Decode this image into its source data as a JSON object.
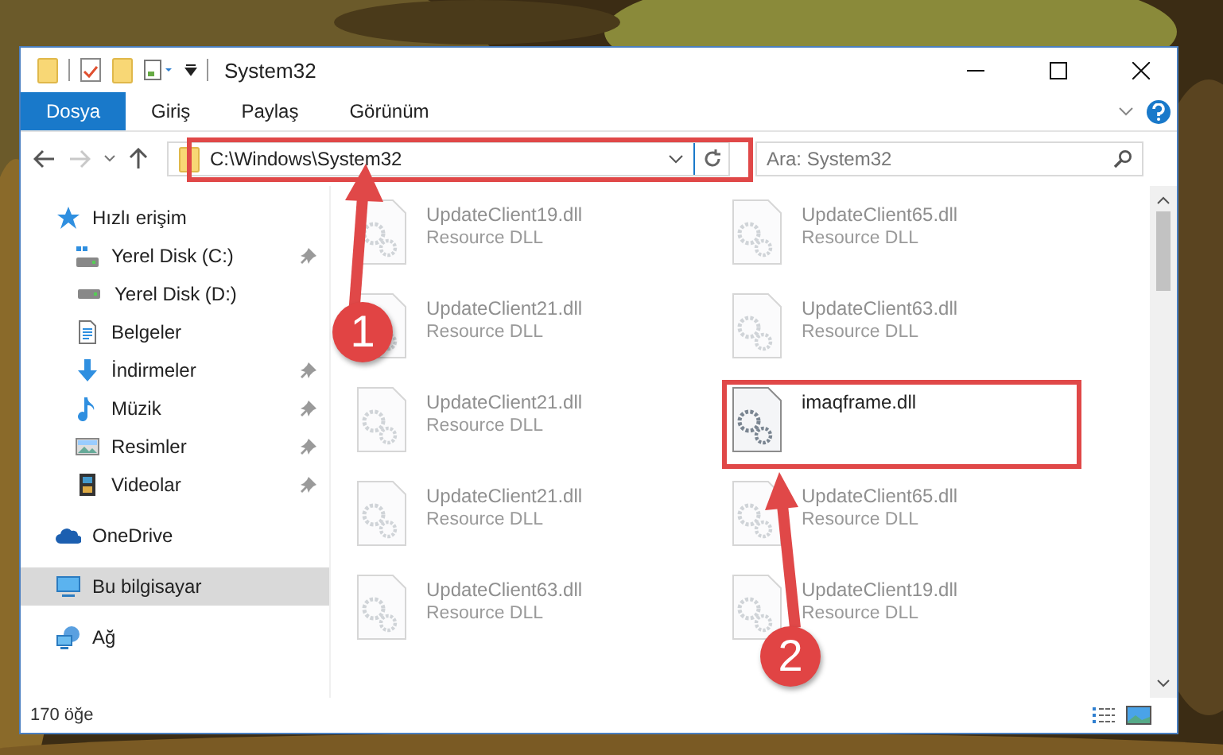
{
  "window": {
    "title": "System32"
  },
  "ribbon_tabs": [
    {
      "label": "Dosya",
      "selected": true
    },
    {
      "label": "Giriş",
      "selected": false
    },
    {
      "label": "Paylaş",
      "selected": false
    },
    {
      "label": "Görünüm",
      "selected": false
    }
  ],
  "address_bar": {
    "path": "C:\\Windows\\System32"
  },
  "search": {
    "placeholder": "Ara: System32"
  },
  "sidebar": {
    "items": [
      {
        "label": "Hızlı erişim",
        "kind": "star",
        "pinned": false,
        "selected": false,
        "children": [
          {
            "label": "Yerel Disk (C:)",
            "kind": "disk-c",
            "pinned": true,
            "selected": false
          },
          {
            "label": "Yerel Disk (D:)",
            "kind": "disk",
            "pinned": false,
            "selected": false
          },
          {
            "label": "Belgeler",
            "kind": "docs",
            "pinned": false,
            "selected": false
          },
          {
            "label": "İndirmeler",
            "kind": "download",
            "pinned": true,
            "selected": false
          },
          {
            "label": "Müzik",
            "kind": "music",
            "pinned": true,
            "selected": false
          },
          {
            "label": "Resimler",
            "kind": "pictures",
            "pinned": true,
            "selected": false
          },
          {
            "label": "Videolar",
            "kind": "video",
            "pinned": true,
            "selected": false
          }
        ]
      },
      {
        "label": "OneDrive",
        "kind": "cloud",
        "pinned": false,
        "selected": false
      },
      {
        "label": "Bu bilgisayar",
        "kind": "computer",
        "pinned": false,
        "selected": true
      },
      {
        "label": "Ağ",
        "kind": "network",
        "pinned": false,
        "selected": false
      }
    ]
  },
  "files": [
    {
      "name": "UpdateClient19.dll",
      "type": "Resource DLL",
      "blurred": true,
      "highlighted": false
    },
    {
      "name": "UpdateClient65.dll",
      "type": "Resource DLL",
      "blurred": true,
      "highlighted": false
    },
    {
      "name": "UpdateClient21.dll",
      "type": "Resource DLL",
      "blurred": true,
      "highlighted": false
    },
    {
      "name": "UpdateClient63.dll",
      "type": "Resource DLL",
      "blurred": true,
      "highlighted": false
    },
    {
      "name": "UpdateClient21.dll",
      "type": "Resource DLL",
      "blurred": true,
      "highlighted": false
    },
    {
      "name": "imaqframe.dll",
      "blurred": false,
      "highlighted": true
    },
    {
      "name": "UpdateClient21.dll",
      "type": "Resource DLL",
      "blurred": true,
      "highlighted": false
    },
    {
      "name": "UpdateClient65.dll",
      "type": "Resource DLL",
      "blurred": true,
      "highlighted": false
    },
    {
      "name": "UpdateClient63.dll",
      "type": "Resource DLL",
      "blurred": true,
      "highlighted": false
    },
    {
      "name": "UpdateClient19.dll",
      "type": "Resource DLL",
      "blurred": true,
      "highlighted": false
    }
  ],
  "status_bar": {
    "count": "170 öğe"
  },
  "annotations": [
    {
      "number": "1"
    },
    {
      "number": "2"
    }
  ]
}
